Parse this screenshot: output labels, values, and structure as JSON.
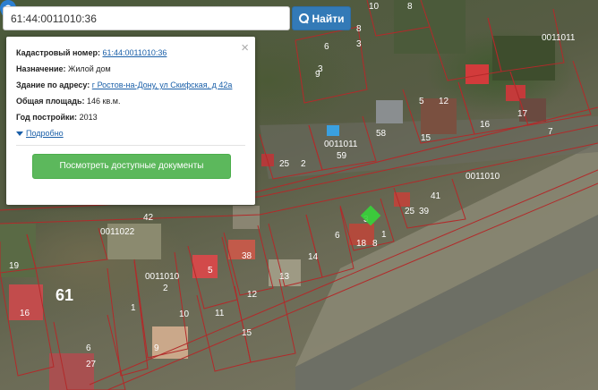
{
  "search": {
    "value": "61:44:0011010:36",
    "button_label": "Найти"
  },
  "popup": {
    "cadastral_label": "Кадастровый номер:",
    "cadastral_value": "61:44:0011010:36",
    "purpose_label": "Назначение:",
    "purpose_value": "Жилой дом",
    "address_label": "Здание по адресу:",
    "address_value": "г Ростов-на-Дону, ул Скифская, д 42а",
    "area_label": "Общая площадь:",
    "area_value": "146 кв.м.",
    "year_label": "Год постройки:",
    "year_value": "2013",
    "more_label": "Подробно",
    "docs_button": "Посмотреть доступные документы",
    "close_symbol": "×"
  },
  "map": {
    "parcel_labels": [
      {
        "t": "0011011"
      },
      {
        "t": "59"
      },
      {
        "t": "58"
      },
      {
        "t": "25"
      },
      {
        "t": "2"
      },
      {
        "t": "0011010"
      },
      {
        "t": "0011022"
      },
      {
        "t": "42"
      },
      {
        "t": "38"
      },
      {
        "t": "14"
      },
      {
        "t": "6"
      },
      {
        "t": "0011010"
      },
      {
        "t": "2"
      },
      {
        "t": "5"
      },
      {
        "t": "12"
      },
      {
        "t": "13"
      },
      {
        "t": "11"
      },
      {
        "t": "1"
      },
      {
        "t": "10"
      },
      {
        "t": "9"
      },
      {
        "t": "12"
      },
      {
        "t": "15"
      },
      {
        "t": "16"
      },
      {
        "t": "17"
      },
      {
        "t": "3"
      },
      {
        "t": "6"
      },
      {
        "t": "5"
      },
      {
        "t": "0011011"
      },
      {
        "t": "8"
      },
      {
        "t": "9"
      },
      {
        "t": "10"
      },
      {
        "t": "8"
      },
      {
        "t": "3"
      },
      {
        "t": "7"
      },
      {
        "t": "39"
      },
      {
        "t": "41"
      },
      {
        "t": "25"
      },
      {
        "t": "16"
      },
      {
        "t": "19"
      },
      {
        "t": "6"
      },
      {
        "t": "27"
      },
      {
        "t": "3"
      },
      {
        "t": "1"
      },
      {
        "t": "18"
      },
      {
        "t": "8"
      },
      {
        "t": "15"
      },
      {
        "t": "61"
      }
    ]
  }
}
